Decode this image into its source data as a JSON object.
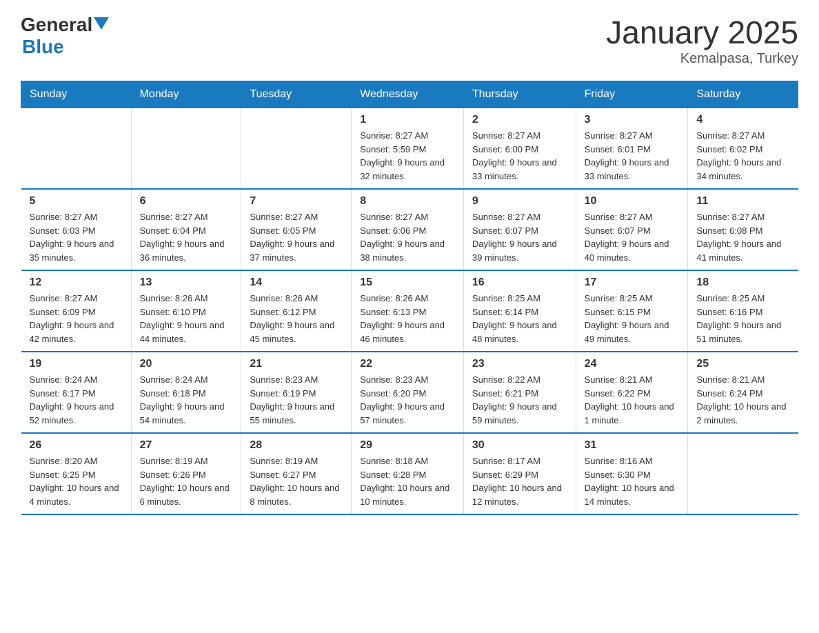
{
  "header": {
    "logo": {
      "text_general": "General",
      "text_blue": "Blue",
      "arrow_title": "GeneralBlue logo arrow"
    },
    "month_title": "January 2025",
    "location": "Kemalpasa, Turkey"
  },
  "calendar": {
    "days_of_week": [
      "Sunday",
      "Monday",
      "Tuesday",
      "Wednesday",
      "Thursday",
      "Friday",
      "Saturday"
    ],
    "weeks": [
      [
        {
          "day": "",
          "info": ""
        },
        {
          "day": "",
          "info": ""
        },
        {
          "day": "",
          "info": ""
        },
        {
          "day": "1",
          "info": "Sunrise: 8:27 AM\nSunset: 5:59 PM\nDaylight: 9 hours and 32 minutes."
        },
        {
          "day": "2",
          "info": "Sunrise: 8:27 AM\nSunset: 6:00 PM\nDaylight: 9 hours and 33 minutes."
        },
        {
          "day": "3",
          "info": "Sunrise: 8:27 AM\nSunset: 6:01 PM\nDaylight: 9 hours and 33 minutes."
        },
        {
          "day": "4",
          "info": "Sunrise: 8:27 AM\nSunset: 6:02 PM\nDaylight: 9 hours and 34 minutes."
        }
      ],
      [
        {
          "day": "5",
          "info": "Sunrise: 8:27 AM\nSunset: 6:03 PM\nDaylight: 9 hours and 35 minutes."
        },
        {
          "day": "6",
          "info": "Sunrise: 8:27 AM\nSunset: 6:04 PM\nDaylight: 9 hours and 36 minutes."
        },
        {
          "day": "7",
          "info": "Sunrise: 8:27 AM\nSunset: 6:05 PM\nDaylight: 9 hours and 37 minutes."
        },
        {
          "day": "8",
          "info": "Sunrise: 8:27 AM\nSunset: 6:06 PM\nDaylight: 9 hours and 38 minutes."
        },
        {
          "day": "9",
          "info": "Sunrise: 8:27 AM\nSunset: 6:07 PM\nDaylight: 9 hours and 39 minutes."
        },
        {
          "day": "10",
          "info": "Sunrise: 8:27 AM\nSunset: 6:07 PM\nDaylight: 9 hours and 40 minutes."
        },
        {
          "day": "11",
          "info": "Sunrise: 8:27 AM\nSunset: 6:08 PM\nDaylight: 9 hours and 41 minutes."
        }
      ],
      [
        {
          "day": "12",
          "info": "Sunrise: 8:27 AM\nSunset: 6:09 PM\nDaylight: 9 hours and 42 minutes."
        },
        {
          "day": "13",
          "info": "Sunrise: 8:26 AM\nSunset: 6:10 PM\nDaylight: 9 hours and 44 minutes."
        },
        {
          "day": "14",
          "info": "Sunrise: 8:26 AM\nSunset: 6:12 PM\nDaylight: 9 hours and 45 minutes."
        },
        {
          "day": "15",
          "info": "Sunrise: 8:26 AM\nSunset: 6:13 PM\nDaylight: 9 hours and 46 minutes."
        },
        {
          "day": "16",
          "info": "Sunrise: 8:25 AM\nSunset: 6:14 PM\nDaylight: 9 hours and 48 minutes."
        },
        {
          "day": "17",
          "info": "Sunrise: 8:25 AM\nSunset: 6:15 PM\nDaylight: 9 hours and 49 minutes."
        },
        {
          "day": "18",
          "info": "Sunrise: 8:25 AM\nSunset: 6:16 PM\nDaylight: 9 hours and 51 minutes."
        }
      ],
      [
        {
          "day": "19",
          "info": "Sunrise: 8:24 AM\nSunset: 6:17 PM\nDaylight: 9 hours and 52 minutes."
        },
        {
          "day": "20",
          "info": "Sunrise: 8:24 AM\nSunset: 6:18 PM\nDaylight: 9 hours and 54 minutes."
        },
        {
          "day": "21",
          "info": "Sunrise: 8:23 AM\nSunset: 6:19 PM\nDaylight: 9 hours and 55 minutes."
        },
        {
          "day": "22",
          "info": "Sunrise: 8:23 AM\nSunset: 6:20 PM\nDaylight: 9 hours and 57 minutes."
        },
        {
          "day": "23",
          "info": "Sunrise: 8:22 AM\nSunset: 6:21 PM\nDaylight: 9 hours and 59 minutes."
        },
        {
          "day": "24",
          "info": "Sunrise: 8:21 AM\nSunset: 6:22 PM\nDaylight: 10 hours and 1 minute."
        },
        {
          "day": "25",
          "info": "Sunrise: 8:21 AM\nSunset: 6:24 PM\nDaylight: 10 hours and 2 minutes."
        }
      ],
      [
        {
          "day": "26",
          "info": "Sunrise: 8:20 AM\nSunset: 6:25 PM\nDaylight: 10 hours and 4 minutes."
        },
        {
          "day": "27",
          "info": "Sunrise: 8:19 AM\nSunset: 6:26 PM\nDaylight: 10 hours and 6 minutes."
        },
        {
          "day": "28",
          "info": "Sunrise: 8:19 AM\nSunset: 6:27 PM\nDaylight: 10 hours and 8 minutes."
        },
        {
          "day": "29",
          "info": "Sunrise: 8:18 AM\nSunset: 6:28 PM\nDaylight: 10 hours and 10 minutes."
        },
        {
          "day": "30",
          "info": "Sunrise: 8:17 AM\nSunset: 6:29 PM\nDaylight: 10 hours and 12 minutes."
        },
        {
          "day": "31",
          "info": "Sunrise: 8:16 AM\nSunset: 6:30 PM\nDaylight: 10 hours and 14 minutes."
        },
        {
          "day": "",
          "info": ""
        }
      ]
    ]
  }
}
